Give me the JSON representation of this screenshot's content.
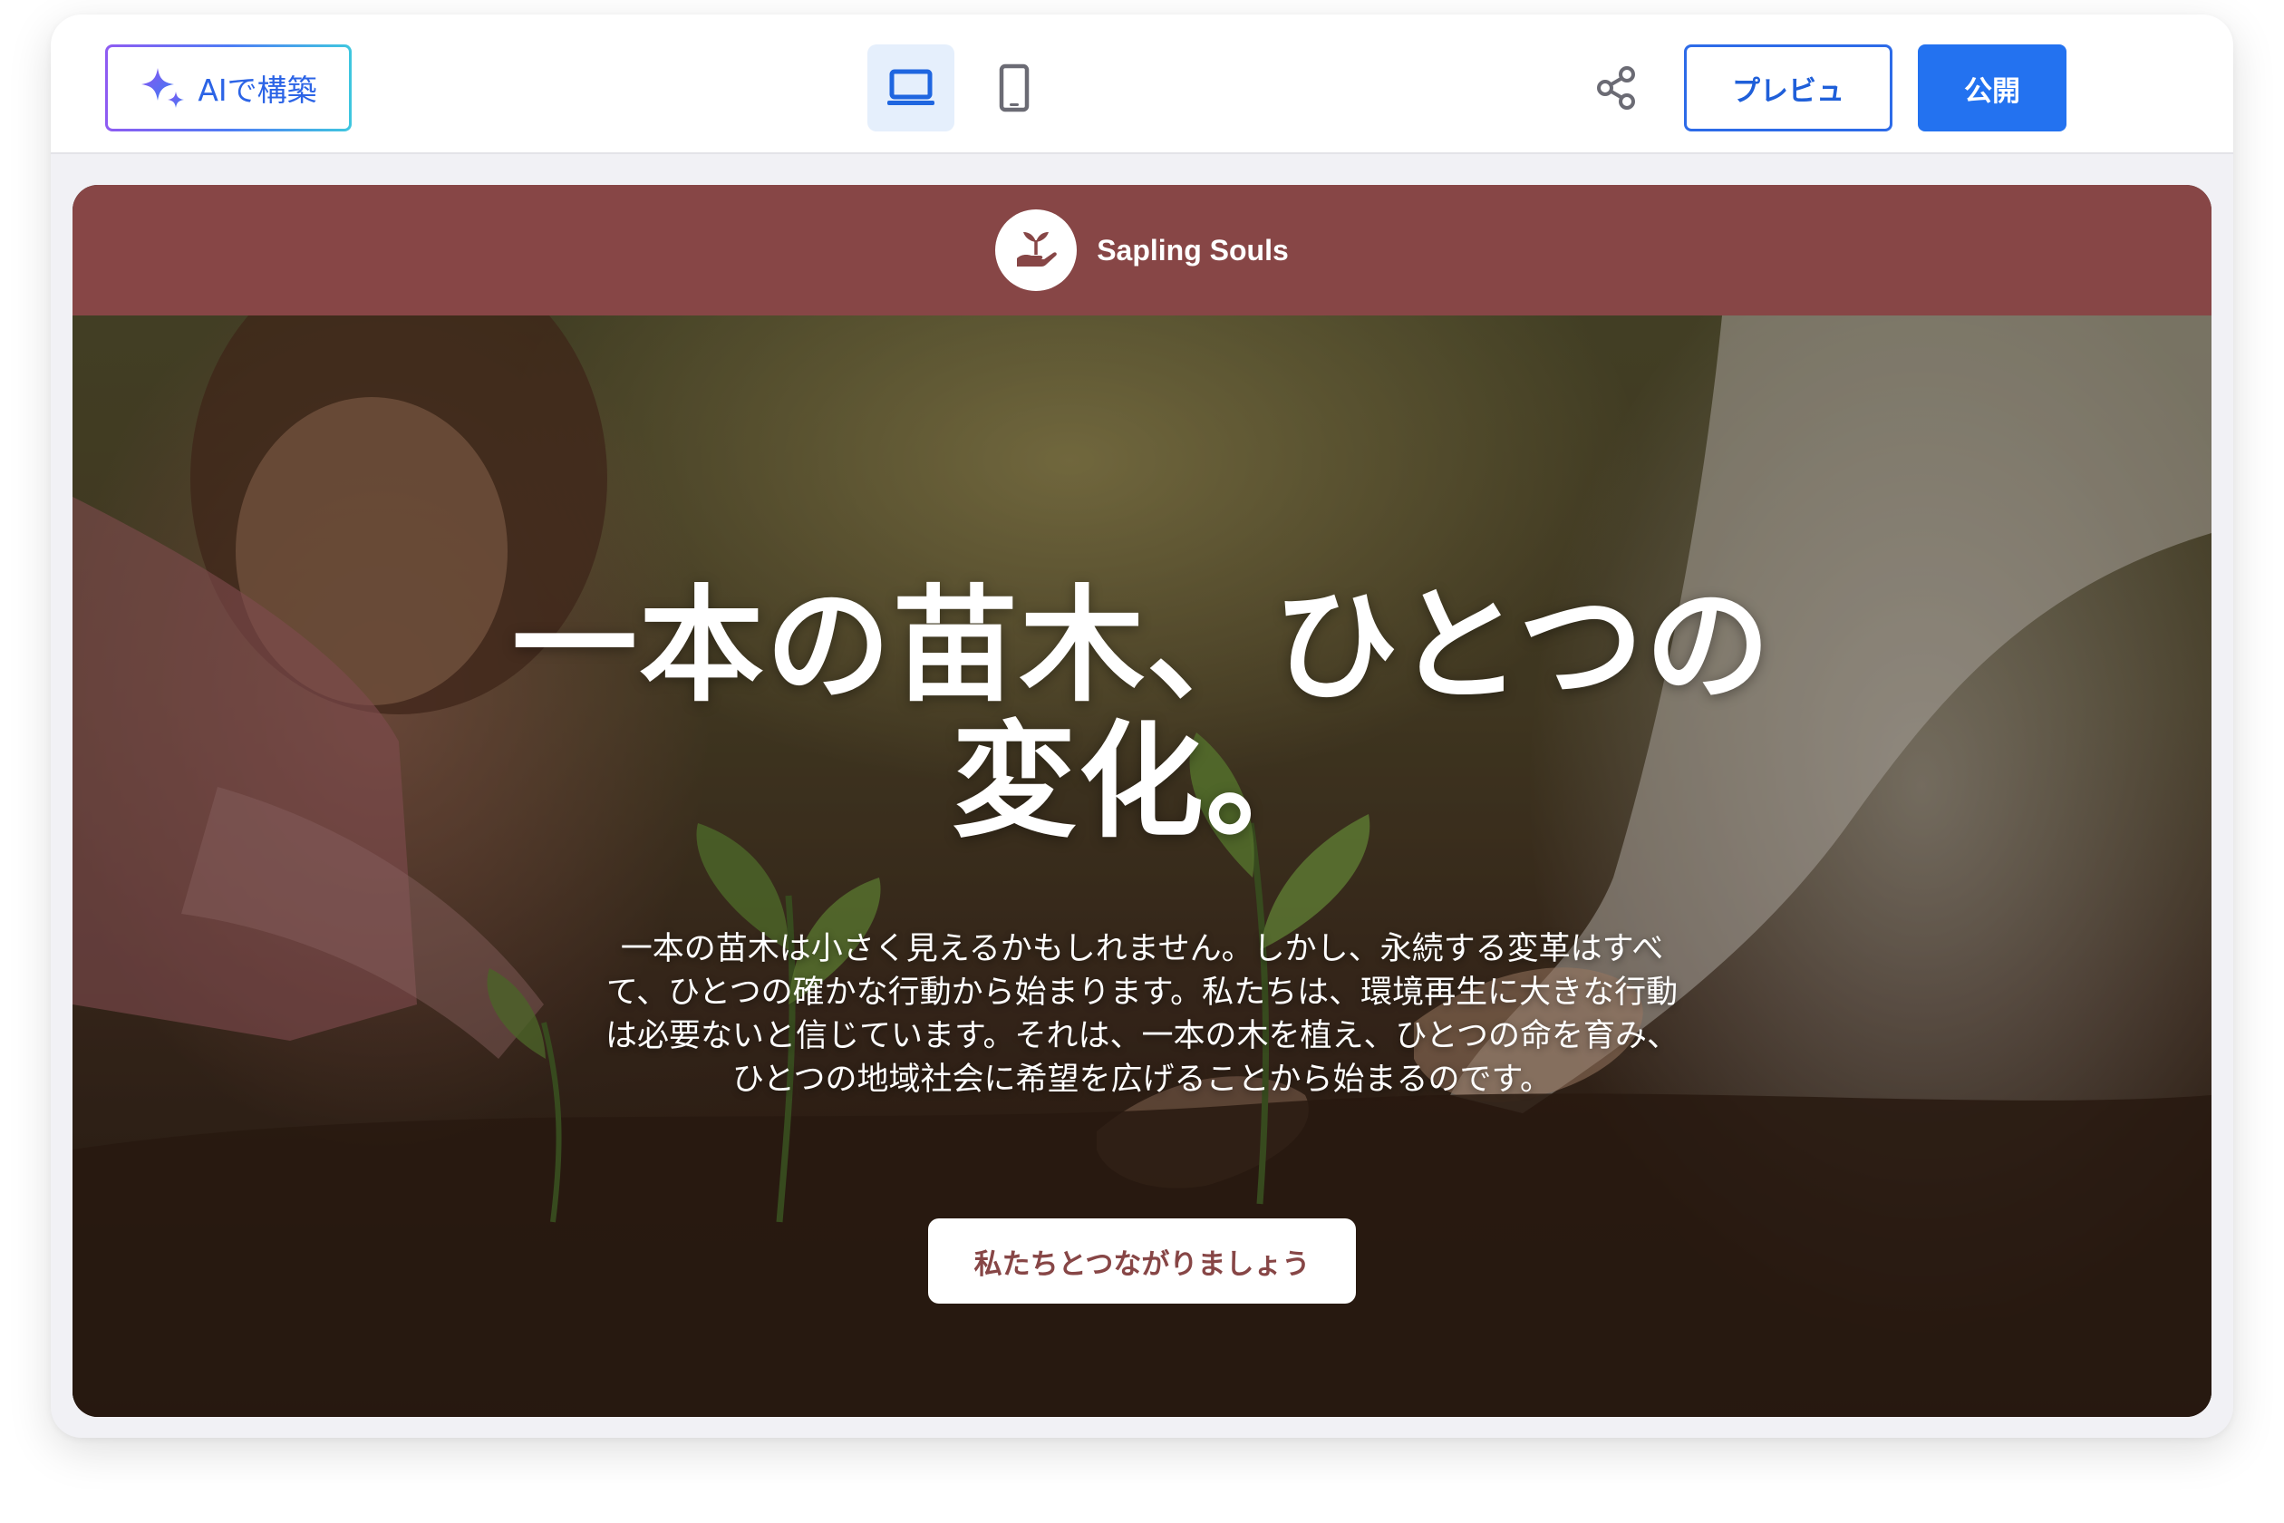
{
  "toolbar": {
    "ai_build_label": "AIで構築",
    "ai_icon": "sparkle-icon",
    "desktop_view_icon": "laptop-icon",
    "mobile_view_icon": "smartphone-icon",
    "share_icon": "share-icon",
    "preview_label": "プレビュ",
    "publish_label": "公開",
    "accent_color": "#2372f0"
  },
  "site": {
    "header_color": "#874646",
    "logo_icon": "seedling-in-hand-icon",
    "brand_name": "Sapling Souls",
    "hero": {
      "headline_line1": "一本の苗木、ひとつの",
      "headline_line2": "変化。",
      "body": "一本の苗木は小さく見えるかもしれません。しかし、永続する変革はすべて、ひとつの確かな行動から始まります。私たちは、環境再生に大きな行動は必要ないと信じています。それは、一本の木を植え、ひとつの命を育み、ひとつの地域社会に希望を広げることから始まるのです。",
      "cta_label": "私たちとつながりましょう",
      "image_alt_icon": "planting-seedlings-photo"
    }
  }
}
